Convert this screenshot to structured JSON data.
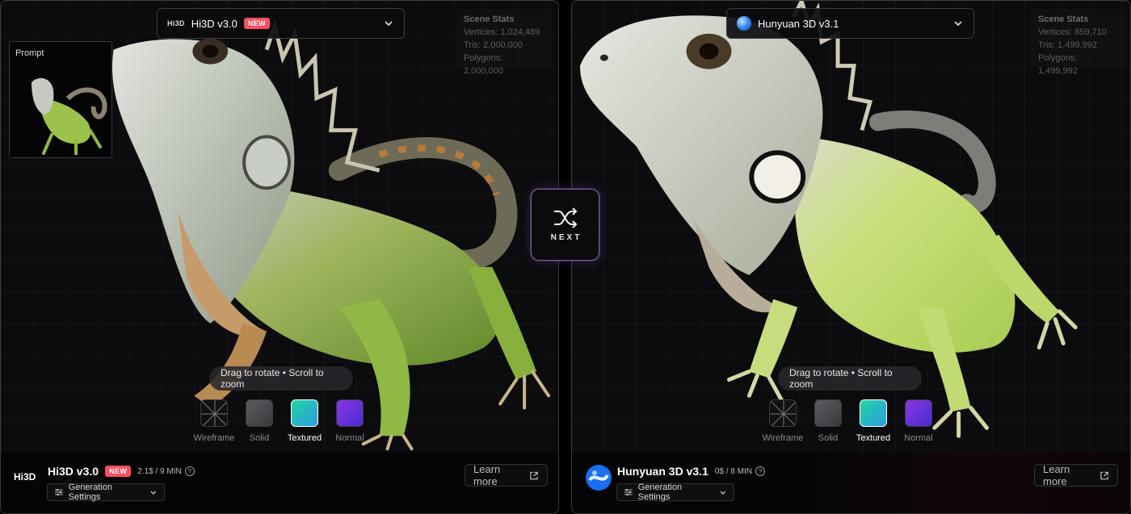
{
  "left": {
    "model_name": "Hi3D v3.0",
    "badge": "NEW",
    "logo_text": "Hi3D",
    "stats": {
      "header": "Scene Stats",
      "vertices": "Vertices: 1,024,489",
      "tris": "Tris: 2,000,000",
      "polygons": "Polygons: 2,000,000"
    },
    "prompt_label": "Prompt",
    "hint": "Drag to rotate • Scroll to zoom",
    "modes": [
      "Wireframe",
      "Solid",
      "Textured",
      "Normal"
    ],
    "active_mode": "Textured",
    "footer": {
      "title": "Hi3D v3.0",
      "badge": "NEW",
      "price": "2.1$ / 9 MIN",
      "settings_label": "Generation Settings",
      "learn_more": "Learn more"
    }
  },
  "right": {
    "model_name": "Hunyuan 3D v3.1",
    "stats": {
      "header": "Scene Stats",
      "vertices": "Vertices: 859,710",
      "tris": "Tris: 1,499,992",
      "polygons": "Polygons: 1,499,992"
    },
    "hint": "Drag to rotate • Scroll to zoom",
    "modes": [
      "Wireframe",
      "Solid",
      "Textured",
      "Normal"
    ],
    "active_mode": "Textured",
    "footer": {
      "title": "Hunyuan 3D v3.1",
      "price": "0$ / 8 MIN",
      "settings_label": "Generation Settings",
      "learn_more": "Learn more"
    }
  },
  "next_button": {
    "label": "NEXT",
    "icon": "shuffle-icon"
  },
  "colors": {
    "accent_new": "#ff4d5e",
    "textured_swatch": "#1fd6a3",
    "normal_swatch": "#8a38e0",
    "iguana_green": "#8bbf3a",
    "iguana_gray": "#b9bdb8"
  }
}
